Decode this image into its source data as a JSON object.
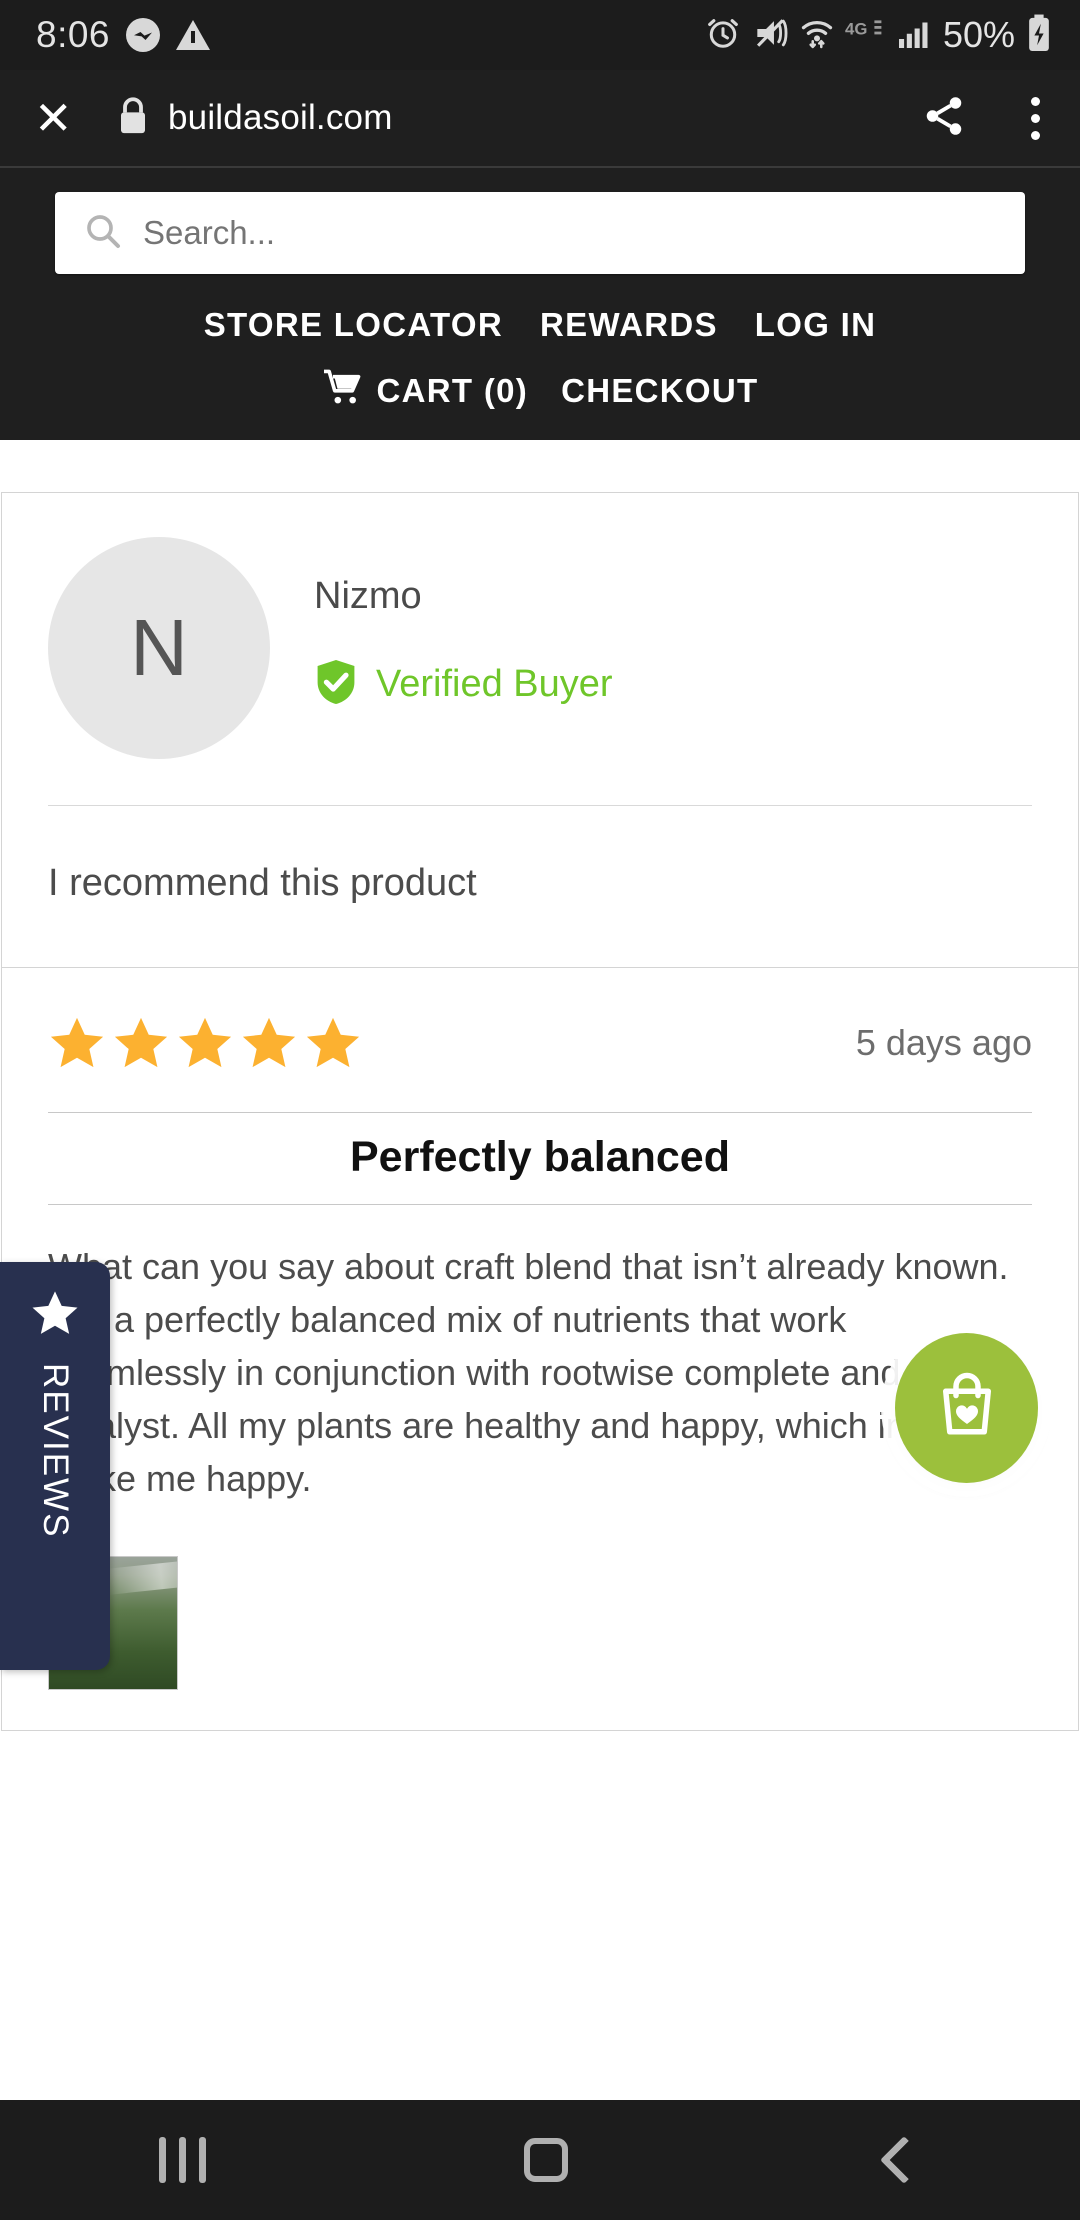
{
  "status_bar": {
    "time": "8:06",
    "battery_percent": "50%",
    "icons": [
      "messenger-icon",
      "warning-triangle-icon",
      "alarm-icon",
      "vibrate-mute-icon",
      "wifi-icon",
      "network-4g-icon",
      "signal-bars-icon",
      "battery-charging-icon"
    ]
  },
  "browser_bar": {
    "close_label": "✕",
    "url": "buildasoil.com",
    "icons": [
      "close-icon",
      "lock-icon",
      "share-icon",
      "overflow-menu-icon"
    ]
  },
  "site_header": {
    "search": {
      "value": "",
      "placeholder": "Search..."
    },
    "nav_primary": [
      {
        "label": "STORE LOCATOR"
      },
      {
        "label": "REWARDS"
      },
      {
        "label": "LOG IN"
      }
    ],
    "nav_secondary": [
      {
        "label": "CART (0)",
        "icon": "shopping-cart-icon"
      },
      {
        "label": "CHECKOUT",
        "icon": ""
      }
    ]
  },
  "reviews_tab": {
    "label": "REVIEWS",
    "icon": "star-icon"
  },
  "review": {
    "author": "Nizmo",
    "avatar_initial": "N",
    "verified_badge": {
      "label": "Verified Buyer",
      "icon": "shield-check-icon",
      "color": "#6fc62a"
    },
    "recommendation": "I recommend this product",
    "rating": 5,
    "stars_filled": "★★★★★",
    "star_color": "#fcb130",
    "date": "5 days ago",
    "title": "Perfectly balanced",
    "body": "What can you say about craft blend that isn’t already known. It is a perfectly balanced mix of nutrients that work seamlessly in conjunction with rootwise complete and bio-catalyst. All my plants are healthy and happy, which in turn make me happy.",
    "photos": [
      {
        "alt": "plant-photo-thumbnail"
      }
    ]
  },
  "floating_button": {
    "icon": "wishlist-bag-heart-icon",
    "color": "#9cc03c"
  },
  "android_nav": {
    "recents": "recents-icon",
    "home": "home-icon",
    "back": "back-icon"
  },
  "theme": {
    "header_bg": "#1f1f1f",
    "accent_green": "#9cc03c",
    "tab_navy": "#28304f"
  }
}
